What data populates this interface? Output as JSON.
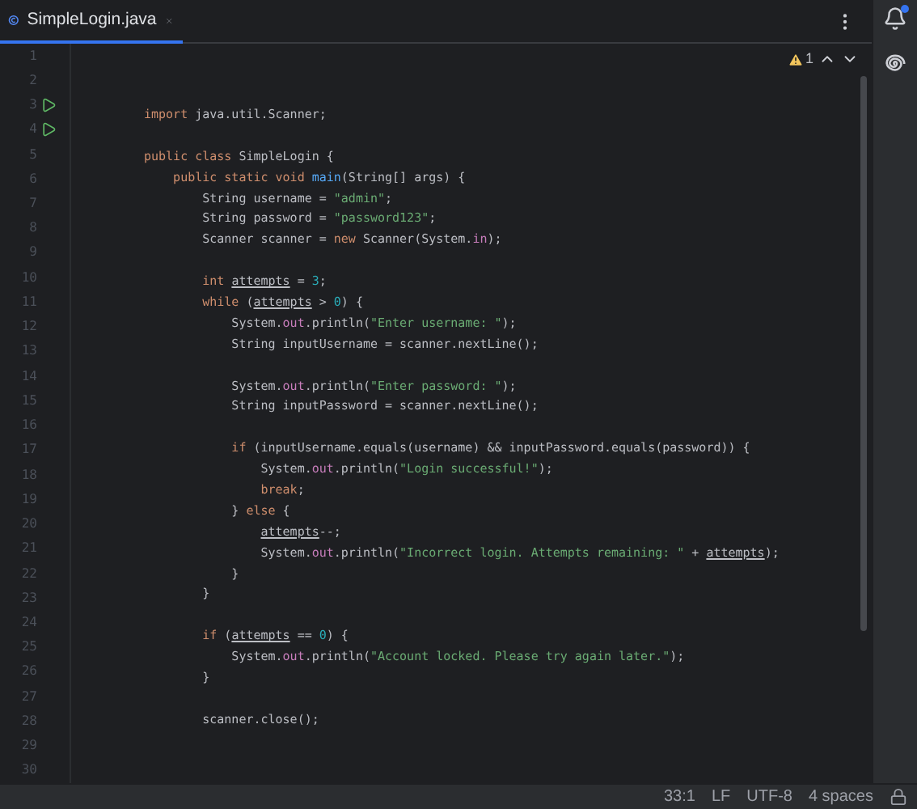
{
  "tab": {
    "label": "SimpleLogin.java",
    "selected": true
  },
  "inspections": {
    "warnings": "1"
  },
  "gutter": [
    {
      "number": "1",
      "run": false
    },
    {
      "number": "2",
      "run": false
    },
    {
      "number": "3",
      "run": true
    },
    {
      "number": "4",
      "run": true
    },
    {
      "number": "5",
      "run": false
    },
    {
      "number": "6",
      "run": false
    },
    {
      "number": "7",
      "run": false
    },
    {
      "number": "8",
      "run": false
    },
    {
      "number": "9",
      "run": false
    },
    {
      "number": "10",
      "run": false
    },
    {
      "number": "11",
      "run": false
    },
    {
      "number": "12",
      "run": false
    },
    {
      "number": "13",
      "run": false
    },
    {
      "number": "14",
      "run": false
    },
    {
      "number": "15",
      "run": false
    },
    {
      "number": "16",
      "run": false
    },
    {
      "number": "17",
      "run": false
    },
    {
      "number": "18",
      "run": false
    },
    {
      "number": "19",
      "run": false
    },
    {
      "number": "20",
      "run": false
    },
    {
      "number": "21",
      "run": false
    },
    {
      "number": "22",
      "run": false
    },
    {
      "number": "23",
      "run": false
    },
    {
      "number": "24",
      "run": false
    },
    {
      "number": "25",
      "run": false
    },
    {
      "number": "26",
      "run": false
    },
    {
      "number": "27",
      "run": false
    },
    {
      "number": "28",
      "run": false
    },
    {
      "number": "29",
      "run": false
    },
    {
      "number": "30",
      "run": false
    }
  ],
  "code_lines": [
    {
      "kind": "code",
      "tokens": [
        {
          "kind": "keyword",
          "text": "import"
        },
        {
          "kind": "plain",
          "text": " java.util.Scanner;"
        }
      ]
    },
    {
      "kind": "blank"
    },
    {
      "kind": "code",
      "tokens": [
        {
          "kind": "keyword",
          "text": "public class"
        },
        {
          "kind": "plain",
          "text": " SimpleLogin {"
        }
      ]
    },
    {
      "kind": "code",
      "tokens": [
        {
          "kind": "keyword",
          "text": "    public static void "
        },
        {
          "kind": "method",
          "text": "main"
        },
        {
          "kind": "plain",
          "text": "(String[] args) {"
        }
      ]
    },
    {
      "kind": "code",
      "tokens": [
        {
          "kind": "plain",
          "text": "        String username = "
        },
        {
          "kind": "string",
          "text": "\"admin\""
        },
        {
          "kind": "plain",
          "text": ";"
        }
      ]
    },
    {
      "kind": "code",
      "tokens": [
        {
          "kind": "plain",
          "text": "        String password = "
        },
        {
          "kind": "string",
          "text": "\"password123\""
        },
        {
          "kind": "plain",
          "text": ";"
        }
      ]
    },
    {
      "kind": "code",
      "tokens": [
        {
          "kind": "plain",
          "text": "        Scanner scanner = "
        },
        {
          "kind": "keyword",
          "text": "new"
        },
        {
          "kind": "plain",
          "text": " Scanner(System."
        },
        {
          "kind": "field",
          "text": "in"
        },
        {
          "kind": "plain",
          "text": ");"
        }
      ]
    },
    {
      "kind": "blank"
    },
    {
      "kind": "code",
      "tokens": [
        {
          "kind": "keyword",
          "text": "        int "
        },
        {
          "kind": "variable",
          "text": "attempts"
        },
        {
          "kind": "plain",
          "text": " = "
        },
        {
          "kind": "number",
          "text": "3"
        },
        {
          "kind": "plain",
          "text": ";"
        }
      ]
    },
    {
      "kind": "code",
      "tokens": [
        {
          "kind": "keyword",
          "text": "        while"
        },
        {
          "kind": "plain",
          "text": " ("
        },
        {
          "kind": "variable",
          "text": "attempts"
        },
        {
          "kind": "plain",
          "text": " > "
        },
        {
          "kind": "number",
          "text": "0"
        },
        {
          "kind": "plain",
          "text": ") {"
        }
      ]
    },
    {
      "kind": "code",
      "tokens": [
        {
          "kind": "plain",
          "text": "            System."
        },
        {
          "kind": "field",
          "text": "out"
        },
        {
          "kind": "plain",
          "text": ".println("
        },
        {
          "kind": "string",
          "text": "\"Enter username: \""
        },
        {
          "kind": "plain",
          "text": ");"
        }
      ]
    },
    {
      "kind": "code",
      "tokens": [
        {
          "kind": "plain",
          "text": "            String inputUsername = scanner.nextLine();"
        }
      ]
    },
    {
      "kind": "blank"
    },
    {
      "kind": "code",
      "tokens": [
        {
          "kind": "plain",
          "text": "            System."
        },
        {
          "kind": "field",
          "text": "out"
        },
        {
          "kind": "plain",
          "text": ".println("
        },
        {
          "kind": "string",
          "text": "\"Enter password: \""
        },
        {
          "kind": "plain",
          "text": ");"
        }
      ]
    },
    {
      "kind": "code",
      "tokens": [
        {
          "kind": "plain",
          "text": "            String inputPassword = scanner.nextLine();"
        }
      ]
    },
    {
      "kind": "blank"
    },
    {
      "kind": "code",
      "tokens": [
        {
          "kind": "keyword",
          "text": "            if"
        },
        {
          "kind": "plain",
          "text": " (inputUsername.equals(username) && inputPassword.equals(password)) {"
        }
      ]
    },
    {
      "kind": "code",
      "tokens": [
        {
          "kind": "plain",
          "text": "                System."
        },
        {
          "kind": "field",
          "text": "out"
        },
        {
          "kind": "plain",
          "text": ".println("
        },
        {
          "kind": "string",
          "text": "\"Login successful!\""
        },
        {
          "kind": "plain",
          "text": ");"
        }
      ]
    },
    {
      "kind": "code",
      "tokens": [
        {
          "kind": "keyword",
          "text": "                break"
        },
        {
          "kind": "plain",
          "text": ";"
        }
      ]
    },
    {
      "kind": "code",
      "tokens": [
        {
          "kind": "plain",
          "text": "            } "
        },
        {
          "kind": "keyword",
          "text": "else"
        },
        {
          "kind": "plain",
          "text": " {"
        }
      ]
    },
    {
      "kind": "code",
      "tokens": [
        {
          "kind": "variable",
          "text": "                attempts"
        },
        {
          "kind": "plain",
          "text": "--;"
        }
      ]
    },
    {
      "kind": "code",
      "tokens": [
        {
          "kind": "plain",
          "text": "                System."
        },
        {
          "kind": "field",
          "text": "out"
        },
        {
          "kind": "plain",
          "text": ".println("
        },
        {
          "kind": "string",
          "text": "\"Incorrect login. Attempts remaining: \""
        },
        {
          "kind": "plain",
          "text": " + "
        },
        {
          "kind": "variable",
          "text": "attempts"
        },
        {
          "kind": "plain",
          "text": ");"
        }
      ]
    },
    {
      "kind": "code",
      "tokens": [
        {
          "kind": "plain",
          "text": "            }"
        }
      ]
    },
    {
      "kind": "code",
      "tokens": [
        {
          "kind": "plain",
          "text": "        }"
        }
      ]
    },
    {
      "kind": "blank"
    },
    {
      "kind": "code",
      "tokens": [
        {
          "kind": "keyword",
          "text": "        if"
        },
        {
          "kind": "plain",
          "text": " ("
        },
        {
          "kind": "variable",
          "text": "attempts"
        },
        {
          "kind": "plain",
          "text": " == "
        },
        {
          "kind": "number",
          "text": "0"
        },
        {
          "kind": "plain",
          "text": ") {"
        }
      ]
    },
    {
      "kind": "code",
      "tokens": [
        {
          "kind": "plain",
          "text": "            System."
        },
        {
          "kind": "field",
          "text": "out"
        },
        {
          "kind": "plain",
          "text": ".println("
        },
        {
          "kind": "string",
          "text": "\"Account locked. Please try again later.\""
        },
        {
          "kind": "plain",
          "text": ");"
        }
      ]
    },
    {
      "kind": "code",
      "tokens": [
        {
          "kind": "plain",
          "text": "        }"
        }
      ]
    },
    {
      "kind": "blank"
    },
    {
      "kind": "code",
      "tokens": [
        {
          "kind": "plain",
          "text": "        scanner.close();"
        }
      ]
    }
  ],
  "status_bar": {
    "position": "33:1",
    "line_separator": "LF",
    "encoding": "UTF-8",
    "indent": "4 spaces"
  }
}
